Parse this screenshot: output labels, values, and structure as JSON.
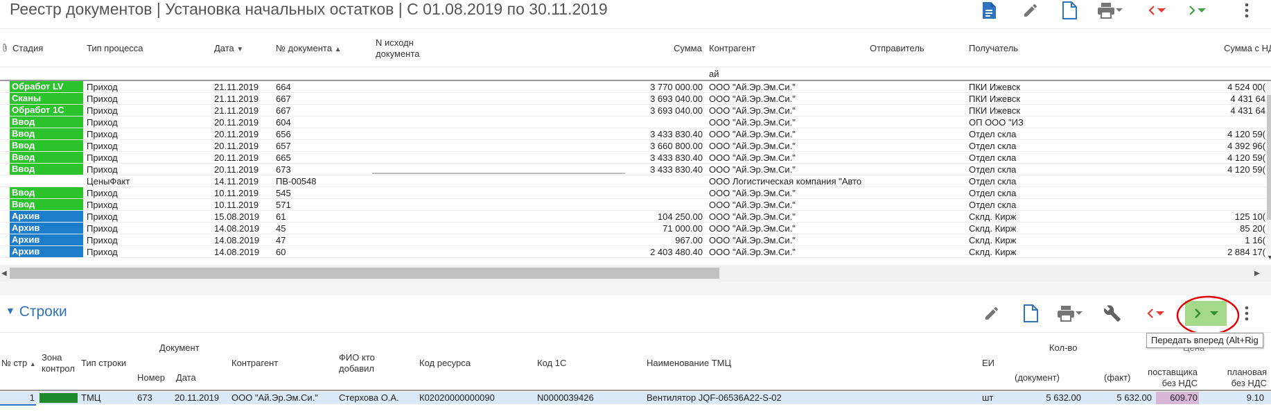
{
  "header": {
    "title": "Реестр документов | Установка начальных остатков | С 01.08.2019 по 30.11.2019"
  },
  "grid": {
    "columns": {
      "stage": "Стадия",
      "process": "Тип процесса",
      "date": "Дата",
      "docno": "№ документа",
      "srcdoc": "N исходн документа",
      "sum": "Сумма",
      "contractor": "Контрагент",
      "sender": "Отправитель",
      "receiver": "Получатель",
      "sumvat": "Сумма с НД"
    },
    "filter_contractor": "ай",
    "rows": [
      {
        "stage": "Обработ LV",
        "color": "green",
        "process": "Приход",
        "date": "21.11.2019",
        "docno": "664",
        "sum": "3 770 000.00",
        "contractor": "ООО \"Ай.Эр.Эм.Си.\"",
        "receiver": "ПКИ Ижевск",
        "sumvat": "4 524 00("
      },
      {
        "stage": "Сканы",
        "color": "green",
        "process": "Приход",
        "date": "21.11.2019",
        "docno": "667",
        "sum": "3 693 040.00",
        "contractor": "ООО \"Ай.Эр.Эм.Си.\"",
        "receiver": "ПКИ Ижевск",
        "sumvat": "4 431 64"
      },
      {
        "stage": "Обработ 1С",
        "color": "green",
        "process": "Приход",
        "date": "21.11.2019",
        "docno": "667",
        "sum": "3 693 040.00",
        "contractor": "ООО \"Ай.Эр.Эм.Си.\"",
        "receiver": "ПКИ Ижевск",
        "sumvat": "4 431 64"
      },
      {
        "stage": "Ввод",
        "color": "green",
        "process": "Приход",
        "date": "20.11.2019",
        "docno": "604",
        "sum": "",
        "contractor": "ООО \"Ай.Эр.Эм.Си.\"",
        "receiver": "ОП ООО \"ИЗ",
        "sumvat": ""
      },
      {
        "stage": "Ввод",
        "color": "green",
        "process": "Приход",
        "date": "20.11.2019",
        "docno": "656",
        "sum": "3 433 830.40",
        "contractor": "ООО \"Ай.Эр.Эм.Си.\"",
        "receiver": "Отдел скла",
        "sumvat": "4 120 59("
      },
      {
        "stage": "Ввод",
        "color": "green",
        "process": "Приход",
        "date": "20.11.2019",
        "docno": "657",
        "sum": "3 660 800.00",
        "contractor": "ООО \"Ай.Эр.Эм.Си.\"",
        "receiver": "Отдел скла",
        "sumvat": "4 392 96("
      },
      {
        "stage": "Ввод",
        "color": "green",
        "process": "Приход",
        "date": "20.11.2019",
        "docno": "665",
        "sum": "3 433 830.40",
        "contractor": "ООО \"Ай.Эр.Эм.Си.\"",
        "receiver": "Отдел скла",
        "sumvat": "4 120 59("
      },
      {
        "stage": "Ввод",
        "color": "green",
        "process": "Приход",
        "date": "20.11.2019",
        "docno": "673",
        "sum": "3 433 830.40",
        "contractor": "ООО \"Ай.Эр.Эм.Си.\"",
        "receiver": "Отдел скла",
        "sumvat": "4 120 59("
      },
      {
        "stage": "",
        "color": "none",
        "process": "ЦеныФакт",
        "date": "14.11.2019",
        "docno": "ПВ-00548",
        "sum": "",
        "contractor": "ООО Логистическая компания \"Авто",
        "receiver": "Отдел скла",
        "sumvat": ""
      },
      {
        "stage": "Ввод",
        "color": "green",
        "process": "Приход",
        "date": "10.11.2019",
        "docno": "545",
        "sum": "",
        "contractor": "ООО \"Ай.Эр.Эм.Си.\"",
        "receiver": "Отдел скла",
        "sumvat": ""
      },
      {
        "stage": "Ввод",
        "color": "green",
        "process": "Приход",
        "date": "10.11.2019",
        "docno": "571",
        "sum": "",
        "contractor": "ООО \"Ай.Эр.Эм.Си.\"",
        "receiver": "Отдел скла",
        "sumvat": ""
      },
      {
        "stage": "Архив",
        "color": "blue",
        "process": "Приход",
        "date": "15.08.2019",
        "docno": "61",
        "sum": "104 250.00",
        "contractor": "ООО \"Ай.Эр.Эм.Си.\"",
        "receiver": "Склд. Кирж",
        "sumvat": "125 10("
      },
      {
        "stage": "Архив",
        "color": "blue",
        "process": "Приход",
        "date": "14.08.2019",
        "docno": "45",
        "sum": "71 000.00",
        "contractor": "ООО \"Ай.Эр.Эм.Си.\"",
        "receiver": "Склд. Кирж",
        "sumvat": "85 20("
      },
      {
        "stage": "Архив",
        "color": "blue",
        "process": "Приход",
        "date": "14.08.2019",
        "docno": "47",
        "sum": "967.00",
        "contractor": "ООО \"Ай.Эр.Эм.Си.\"",
        "receiver": "Склд. Кирж",
        "sumvat": "1 16("
      },
      {
        "stage": "Архив",
        "color": "blue",
        "process": "Приход",
        "date": "14.08.2019",
        "docno": "60",
        "sum": "2 403 480.40",
        "contractor": "ООО \"Ай.Эр.Эм.Си.\"",
        "receiver": "Склд. Кирж",
        "sumvat": "2 884 17("
      }
    ]
  },
  "lines": {
    "title": "Строки",
    "tooltip": "Передать вперед (Alt+Rig",
    "columns": {
      "line_no": "№ стр",
      "zone": "Зона контрол",
      "row_type": "Тип строки",
      "doc_group": "Документ",
      "doc_no": "Номер",
      "doc_date": "Дата",
      "contractor": "Контрагент",
      "added_by": "ФИО кто добавил",
      "resource": "Код ресурса",
      "code1c": "Код 1С",
      "name": "Наименование ТМЦ",
      "unit": "ЕИ",
      "qty_group": "Кол-во",
      "qty_doc": "(документ)",
      "qty_fact": "(факт)",
      "price_group": "Цена",
      "price_supplier": "поставщика без НДС",
      "price_planned": "плановая без НДС"
    },
    "rows": [
      {
        "line_no": "1",
        "row_type": "ТМЦ",
        "doc_no": "673",
        "doc_date": "20.11.2019",
        "contractor": "ООО \"Ай.Эр.Эм.Си.\"",
        "added_by": "Стерхова О.А.",
        "resource": "К02020000000090",
        "code1c": "N0000039426",
        "name": "Вентилятор JQF-06536A22-S-02",
        "unit": "шт",
        "qty_doc": "5 632.00",
        "qty_fact": "5 632.00",
        "price_supplier": "609.70",
        "price_planned": "9.10"
      }
    ]
  },
  "colors": {
    "accent_blue": "#2e73c0",
    "stage_green": "#2cc42c",
    "stage_blue": "#1c7ecb",
    "nav_red": "#e53935",
    "nav_green": "#43a047",
    "annotation_red": "#e00000"
  },
  "icons": [
    "document-icon",
    "pencil-icon",
    "new-document-icon",
    "printer-icon",
    "chevron-left-icon",
    "chevron-right-icon",
    "kebab-menu-icon",
    "wrench-icon",
    "paperclip-icon",
    "sort-arrow-icon"
  ]
}
